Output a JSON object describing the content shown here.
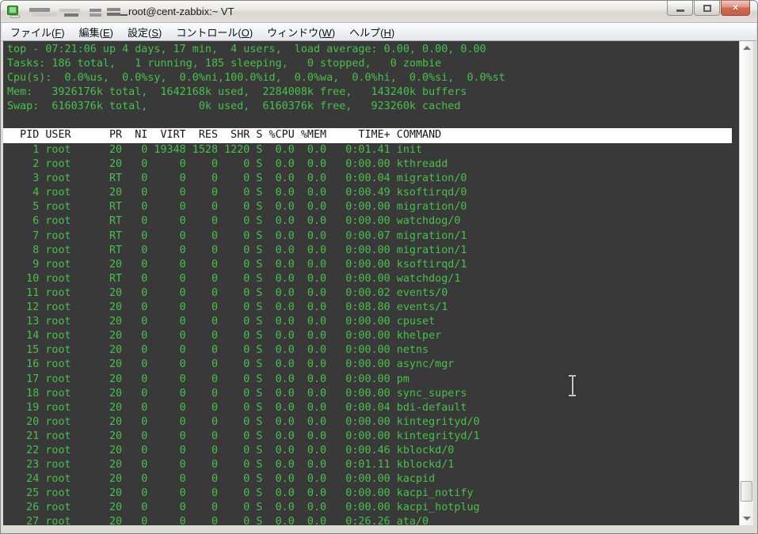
{
  "window": {
    "title": "root@cent-zabbix:~ VT",
    "controls": [
      {
        "name": "minimize",
        "label": ""
      },
      {
        "name": "maximize",
        "label": ""
      },
      {
        "name": "close",
        "label": "×"
      }
    ]
  },
  "menubar": {
    "items": [
      {
        "name": "file",
        "pre": "ファイル(",
        "key": "F",
        "post": ")"
      },
      {
        "name": "edit",
        "pre": "編集(",
        "key": "E",
        "post": ")"
      },
      {
        "name": "setup",
        "pre": "設定(",
        "key": "S",
        "post": ")"
      },
      {
        "name": "control",
        "pre": "コントロール(",
        "key": "O",
        "post": ")"
      },
      {
        "name": "window",
        "pre": "ウィンドウ(",
        "key": "W",
        "post": ")"
      },
      {
        "name": "help",
        "pre": "ヘルプ(",
        "key": "H",
        "post": ")"
      }
    ]
  },
  "terminal": {
    "colors": {
      "background": "#393939",
      "text_green": "#46c249",
      "header_bg": "#ffffff",
      "header_text": "#161616"
    },
    "summary_lines": [
      "top - 07:21:06 up 4 days, 17 min,  4 users,  load average: 0.00, 0.00, 0.00",
      "Tasks: 186 total,   1 running, 185 sleeping,   0 stopped,   0 zombie",
      "Cpu(s):  0.0%us,  0.0%sy,  0.0%ni,100.0%id,  0.0%wa,  0.0%hi,  0.0%si,  0.0%st",
      "Mem:   3926176k total,  1642168k used,  2284008k free,   143240k buffers",
      "Swap:  6160376k total,        0k used,  6160376k free,   923260k cached"
    ],
    "table": {
      "columns": [
        "PID",
        "USER",
        "PR",
        "NI",
        "VIRT",
        "RES",
        "SHR",
        "S",
        "%CPU",
        "%MEM",
        "TIME+",
        "COMMAND"
      ],
      "processes": [
        {
          "pid": "1",
          "user": "root",
          "pr": "20",
          "ni": "0",
          "virt": "19348",
          "res": "1528",
          "shr": "1220",
          "s": "S",
          "cpu": "0.0",
          "mem": "0.0",
          "time": "0:01.41",
          "command": "init"
        },
        {
          "pid": "2",
          "user": "root",
          "pr": "20",
          "ni": "0",
          "virt": "0",
          "res": "0",
          "shr": "0",
          "s": "S",
          "cpu": "0.0",
          "mem": "0.0",
          "time": "0:00.00",
          "command": "kthreadd"
        },
        {
          "pid": "3",
          "user": "root",
          "pr": "RT",
          "ni": "0",
          "virt": "0",
          "res": "0",
          "shr": "0",
          "s": "S",
          "cpu": "0.0",
          "mem": "0.0",
          "time": "0:00.04",
          "command": "migration/0"
        },
        {
          "pid": "4",
          "user": "root",
          "pr": "20",
          "ni": "0",
          "virt": "0",
          "res": "0",
          "shr": "0",
          "s": "S",
          "cpu": "0.0",
          "mem": "0.0",
          "time": "0:00.49",
          "command": "ksoftirqd/0"
        },
        {
          "pid": "5",
          "user": "root",
          "pr": "RT",
          "ni": "0",
          "virt": "0",
          "res": "0",
          "shr": "0",
          "s": "S",
          "cpu": "0.0",
          "mem": "0.0",
          "time": "0:00.00",
          "command": "migration/0"
        },
        {
          "pid": "6",
          "user": "root",
          "pr": "RT",
          "ni": "0",
          "virt": "0",
          "res": "0",
          "shr": "0",
          "s": "S",
          "cpu": "0.0",
          "mem": "0.0",
          "time": "0:00.00",
          "command": "watchdog/0"
        },
        {
          "pid": "7",
          "user": "root",
          "pr": "RT",
          "ni": "0",
          "virt": "0",
          "res": "0",
          "shr": "0",
          "s": "S",
          "cpu": "0.0",
          "mem": "0.0",
          "time": "0:00.07",
          "command": "migration/1"
        },
        {
          "pid": "8",
          "user": "root",
          "pr": "RT",
          "ni": "0",
          "virt": "0",
          "res": "0",
          "shr": "0",
          "s": "S",
          "cpu": "0.0",
          "mem": "0.0",
          "time": "0:00.00",
          "command": "migration/1"
        },
        {
          "pid": "9",
          "user": "root",
          "pr": "20",
          "ni": "0",
          "virt": "0",
          "res": "0",
          "shr": "0",
          "s": "S",
          "cpu": "0.0",
          "mem": "0.0",
          "time": "0:00.00",
          "command": "ksoftirqd/1"
        },
        {
          "pid": "10",
          "user": "root",
          "pr": "RT",
          "ni": "0",
          "virt": "0",
          "res": "0",
          "shr": "0",
          "s": "S",
          "cpu": "0.0",
          "mem": "0.0",
          "time": "0:00.00",
          "command": "watchdog/1"
        },
        {
          "pid": "11",
          "user": "root",
          "pr": "20",
          "ni": "0",
          "virt": "0",
          "res": "0",
          "shr": "0",
          "s": "S",
          "cpu": "0.0",
          "mem": "0.0",
          "time": "0:00.02",
          "command": "events/0"
        },
        {
          "pid": "12",
          "user": "root",
          "pr": "20",
          "ni": "0",
          "virt": "0",
          "res": "0",
          "shr": "0",
          "s": "S",
          "cpu": "0.0",
          "mem": "0.0",
          "time": "0:08.80",
          "command": "events/1"
        },
        {
          "pid": "13",
          "user": "root",
          "pr": "20",
          "ni": "0",
          "virt": "0",
          "res": "0",
          "shr": "0",
          "s": "S",
          "cpu": "0.0",
          "mem": "0.0",
          "time": "0:00.00",
          "command": "cpuset"
        },
        {
          "pid": "14",
          "user": "root",
          "pr": "20",
          "ni": "0",
          "virt": "0",
          "res": "0",
          "shr": "0",
          "s": "S",
          "cpu": "0.0",
          "mem": "0.0",
          "time": "0:00.00",
          "command": "khelper"
        },
        {
          "pid": "15",
          "user": "root",
          "pr": "20",
          "ni": "0",
          "virt": "0",
          "res": "0",
          "shr": "0",
          "s": "S",
          "cpu": "0.0",
          "mem": "0.0",
          "time": "0:00.00",
          "command": "netns"
        },
        {
          "pid": "16",
          "user": "root",
          "pr": "20",
          "ni": "0",
          "virt": "0",
          "res": "0",
          "shr": "0",
          "s": "S",
          "cpu": "0.0",
          "mem": "0.0",
          "time": "0:00.00",
          "command": "async/mgr"
        },
        {
          "pid": "17",
          "user": "root",
          "pr": "20",
          "ni": "0",
          "virt": "0",
          "res": "0",
          "shr": "0",
          "s": "S",
          "cpu": "0.0",
          "mem": "0.0",
          "time": "0:00.00",
          "command": "pm"
        },
        {
          "pid": "18",
          "user": "root",
          "pr": "20",
          "ni": "0",
          "virt": "0",
          "res": "0",
          "shr": "0",
          "s": "S",
          "cpu": "0.0",
          "mem": "0.0",
          "time": "0:00.00",
          "command": "sync_supers"
        },
        {
          "pid": "19",
          "user": "root",
          "pr": "20",
          "ni": "0",
          "virt": "0",
          "res": "0",
          "shr": "0",
          "s": "S",
          "cpu": "0.0",
          "mem": "0.0",
          "time": "0:00.04",
          "command": "bdi-default"
        },
        {
          "pid": "20",
          "user": "root",
          "pr": "20",
          "ni": "0",
          "virt": "0",
          "res": "0",
          "shr": "0",
          "s": "S",
          "cpu": "0.0",
          "mem": "0.0",
          "time": "0:00.00",
          "command": "kintegrityd/0"
        },
        {
          "pid": "21",
          "user": "root",
          "pr": "20",
          "ni": "0",
          "virt": "0",
          "res": "0",
          "shr": "0",
          "s": "S",
          "cpu": "0.0",
          "mem": "0.0",
          "time": "0:00.00",
          "command": "kintegrityd/1"
        },
        {
          "pid": "22",
          "user": "root",
          "pr": "20",
          "ni": "0",
          "virt": "0",
          "res": "0",
          "shr": "0",
          "s": "S",
          "cpu": "0.0",
          "mem": "0.0",
          "time": "0:00.46",
          "command": "kblockd/0"
        },
        {
          "pid": "23",
          "user": "root",
          "pr": "20",
          "ni": "0",
          "virt": "0",
          "res": "0",
          "shr": "0",
          "s": "S",
          "cpu": "0.0",
          "mem": "0.0",
          "time": "0:01.11",
          "command": "kblockd/1"
        },
        {
          "pid": "24",
          "user": "root",
          "pr": "20",
          "ni": "0",
          "virt": "0",
          "res": "0",
          "shr": "0",
          "s": "S",
          "cpu": "0.0",
          "mem": "0.0",
          "time": "0:00.00",
          "command": "kacpid"
        },
        {
          "pid": "25",
          "user": "root",
          "pr": "20",
          "ni": "0",
          "virt": "0",
          "res": "0",
          "shr": "0",
          "s": "S",
          "cpu": "0.0",
          "mem": "0.0",
          "time": "0:00.00",
          "command": "kacpi_notify"
        },
        {
          "pid": "26",
          "user": "root",
          "pr": "20",
          "ni": "0",
          "virt": "0",
          "res": "0",
          "shr": "0",
          "s": "S",
          "cpu": "0.0",
          "mem": "0.0",
          "time": "0:00.00",
          "command": "kacpi_hotplug"
        },
        {
          "pid": "27",
          "user": "root",
          "pr": "20",
          "ni": "0",
          "virt": "0",
          "res": "0",
          "shr": "0",
          "s": "S",
          "cpu": "0.0",
          "mem": "0.0",
          "time": "0:26.26",
          "command": "ata/0"
        }
      ]
    }
  }
}
